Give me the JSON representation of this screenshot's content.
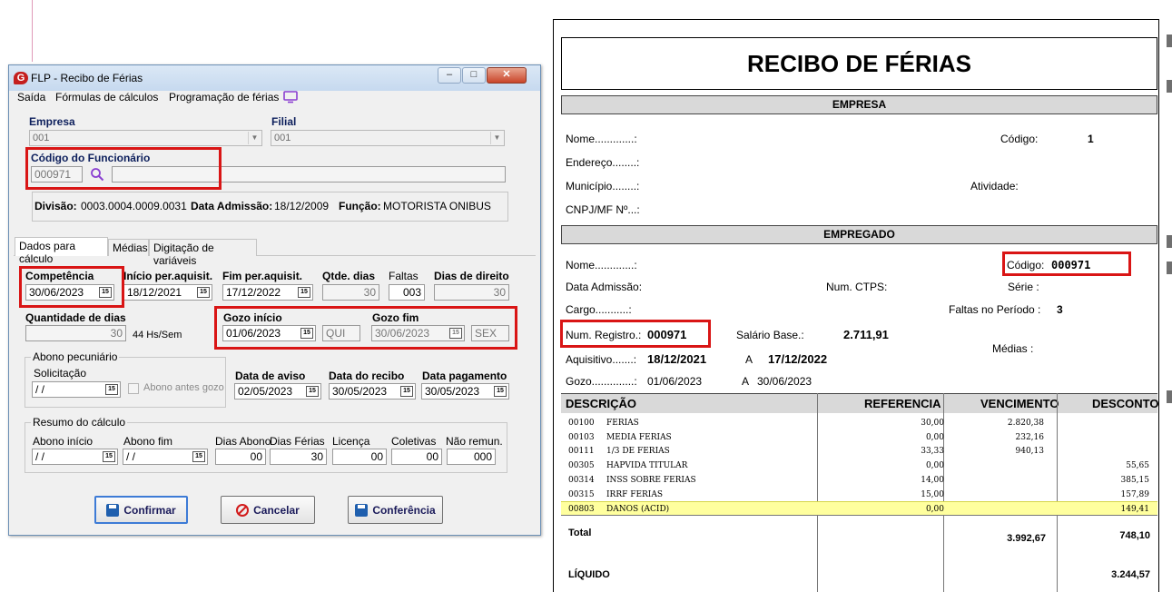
{
  "dialog": {
    "title": "FLP - Recibo de Férias",
    "logo_letter": "G",
    "window_buttons": {
      "minimize": "–",
      "maximize": "□",
      "close": "✕"
    },
    "menu": {
      "sair": "Saída",
      "formulas": "Fórmulas de cálculos",
      "programacao": "Programação de férias"
    },
    "empresa_label": "Empresa",
    "empresa_value": "001",
    "filial_label": "Filial",
    "filial_value": "001",
    "codigo_label": "Código do Funcionário",
    "codigo_value": "000971",
    "info": {
      "divisao_label": "Divisão:",
      "divisao_value": "0003.0004.0009.0031",
      "admissao_label": "Data Admissão:",
      "admissao_value": "18/12/2009",
      "funcao_label": "Função:",
      "funcao_value": "MOTORISTA ONIBUS"
    },
    "tabs": [
      "Dados para cálculo",
      "Médias",
      "Digitação de variáveis"
    ],
    "competencia_label": "Competência",
    "competencia_value": "30/06/2023",
    "inicio_per_label": "Início per.aquisit.",
    "inicio_per_value": "18/12/2021",
    "fim_per_label": "Fim per.aquisit.",
    "fim_per_value": "17/12/2022",
    "qtde_dias_label": "Qtde. dias",
    "qtde_dias_value": "30",
    "faltas_label": "Faltas",
    "faltas_value": "003",
    "dias_direito_label": "Dias de direito",
    "dias_direito_value": "30",
    "quantidade_dias_label": "Quantidade de dias",
    "quantidade_dias_value": "30",
    "horas_semana": "44 Hs/Sem",
    "gozo_inicio_label": "Gozo início",
    "gozo_inicio_value": "01/06/2023",
    "gozo_inicio_day": "QUI",
    "gozo_fim_label": "Gozo fim",
    "gozo_fim_value": "30/06/2023",
    "gozo_fim_day": "SEX",
    "abono_group_title": "Abono pecuniário",
    "solicitacao_label": "Solicitação",
    "solicitacao_value": " / /",
    "abono_antes_label": "Abono antes gozo",
    "data_aviso_label": "Data de aviso",
    "data_aviso_value": "02/05/2023",
    "data_recibo_label": "Data do recibo",
    "data_recibo_value": "30/05/2023",
    "data_pagamento_label": "Data pagamento",
    "data_pagamento_value": "30/05/2023",
    "resumo_group_title": "Resumo do cálculo",
    "abono_inicio_label": "Abono início",
    "abono_inicio_value": " / /",
    "abono_fim_label": "Abono fim",
    "abono_fim_value": " / /",
    "dias_abono_label": "Dias Abono",
    "dias_abono_value": "00",
    "dias_ferias_label": "Dias Férias",
    "dias_ferias_value": "30",
    "licenca_label": "Licença",
    "licenca_value": "00",
    "coletivas_label": "Coletivas",
    "coletivas_value": "00",
    "nao_remun_label": "Não remun.",
    "nao_remun_value": "000",
    "buttons": {
      "confirmar": "Confirmar",
      "cancelar": "Cancelar",
      "conferencia": "Conferência"
    }
  },
  "receipt": {
    "title": "RECIBO DE FÉRIAS",
    "empresa_section": "EMPRESA",
    "empresa": {
      "nome_label": "Nome.............:",
      "codigo_label": "Código:",
      "codigo_value": "1",
      "endereco_label": "Endereço........:",
      "municipio_label": "Município........:",
      "atividade_label": "Atividade:",
      "cnpj_label": "CNPJ/MF Nº...:"
    },
    "empregado_section": "EMPREGADO",
    "empregado": {
      "nome_label": "Nome.............:",
      "codigo_label": "Código:",
      "codigo_value": "000971",
      "admissao_label": "Data Admissão:",
      "ctps_label": "Num. CTPS:",
      "serie_label": "Série :",
      "cargo_label": "Cargo...........:",
      "faltas_label": "Faltas no Período :",
      "faltas_value": "3",
      "registro_label": "Num. Registro.:",
      "registro_value": "000971",
      "salario_label": "Salário Base.:",
      "salario_value": "2.711,91",
      "medias_label": "Médias :",
      "aquisitivo_label": "Aquisitivo.......:",
      "aquisitivo_inicio": "18/12/2021",
      "aquisitivo_a": "A",
      "aquisitivo_fim": "17/12/2022",
      "gozo_label": "Gozo..............:",
      "gozo_inicio": "01/06/2023",
      "gozo_a": "A",
      "gozo_fim": "30/06/2023"
    },
    "table_headers": {
      "descricao": "DESCRIÇÃO",
      "referencia": "REFERENCIA",
      "vencimento": "VENCIMENTO",
      "desconto": "DESCONTO"
    },
    "rows": [
      {
        "codigo": "00100",
        "descricao": "FERIAS",
        "referencia": "30,00",
        "vencimento": "2.820,38",
        "desconto": ""
      },
      {
        "codigo": "00103",
        "descricao": "MEDIA FERIAS",
        "referencia": "0,00",
        "vencimento": "232,16",
        "desconto": ""
      },
      {
        "codigo": "00111",
        "descricao": "1/3 DE FERIAS",
        "referencia": "33,33",
        "vencimento": "940,13",
        "desconto": ""
      },
      {
        "codigo": "00305",
        "descricao": "HAPVIDA TITULAR",
        "referencia": "0,00",
        "vencimento": "",
        "desconto": "55,65"
      },
      {
        "codigo": "00314",
        "descricao": "INSS SOBRE FERIAS",
        "referencia": "14,00",
        "vencimento": "",
        "desconto": "385,15"
      },
      {
        "codigo": "00315",
        "descricao": "IRRF FERIAS",
        "referencia": "15,00",
        "vencimento": "",
        "desconto": "157,89"
      },
      {
        "codigo": "00803",
        "descricao": "DANOS (ACID)",
        "referencia": "0,00",
        "vencimento": "",
        "desconto": "149,41"
      }
    ],
    "total_label": "Total",
    "total_vencimento": "3.992,67",
    "total_desconto": "748,10",
    "liquido_label": "LÍQUIDO",
    "liquido_value": "3.244,57"
  },
  "colors": {
    "highlight_red": "#d91515",
    "row_highlight": "#ffff9e",
    "section_grey": "#d9d9d9",
    "accent_purple": "#8a3fd1"
  }
}
